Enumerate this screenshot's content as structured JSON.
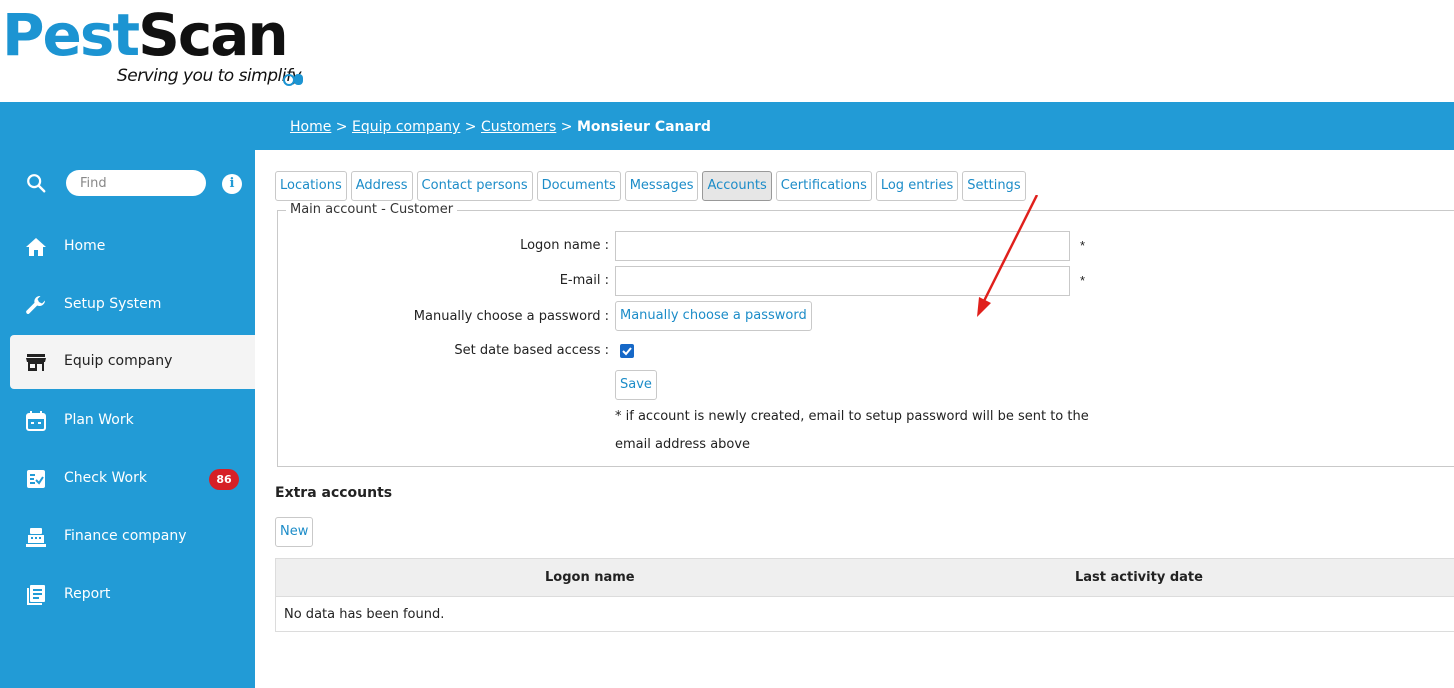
{
  "logo": {
    "word_part1": "Pest",
    "word_part2": "Scan",
    "tagline": "Serving you to simplify"
  },
  "breadcrumb": {
    "home": "Home",
    "sep": ">",
    "company": "Equip company",
    "customers": "Customers",
    "current": "Monsieur Canard"
  },
  "sidebar": {
    "search_placeholder": "Find",
    "info": "i",
    "items": [
      {
        "label": "Home",
        "icon": "home-icon"
      },
      {
        "label": "Setup System",
        "icon": "wrench-icon"
      },
      {
        "label": "Equip company",
        "icon": "store-icon",
        "active": true
      },
      {
        "label": "Plan Work",
        "icon": "calendar-icon"
      },
      {
        "label": "Check Work",
        "icon": "checklist-icon",
        "badge": "86"
      },
      {
        "label": "Finance company",
        "icon": "cash-register-icon"
      },
      {
        "label": "Report",
        "icon": "report-icon"
      }
    ]
  },
  "tabs": [
    "Locations",
    "Address",
    "Contact persons",
    "Documents",
    "Messages",
    "Accounts",
    "Certifications",
    "Log entries",
    "Settings"
  ],
  "active_tab": "Accounts",
  "main_account": {
    "legend": "Main account - Customer",
    "logon_label": "Logon name :",
    "logon_value": "",
    "email_label": "E-mail :",
    "email_value": "",
    "required_mark": "*",
    "password_label": "Manually choose a password :",
    "password_button": "Manually choose a password",
    "date_access_label": "Set date based access :",
    "date_access_checked": true,
    "save_button": "Save",
    "note": "* if account is newly created, email to setup password will be sent to the email address above"
  },
  "extra_accounts": {
    "title": "Extra accounts",
    "new_button": "New",
    "columns": [
      "Logon name",
      "Last activity date"
    ],
    "empty_text": "No data has been found."
  },
  "colors": {
    "brand_blue": "#229bd6",
    "link_blue": "#1c8cc8",
    "badge_red": "#d62027",
    "arrow_red": "#e0201c"
  }
}
